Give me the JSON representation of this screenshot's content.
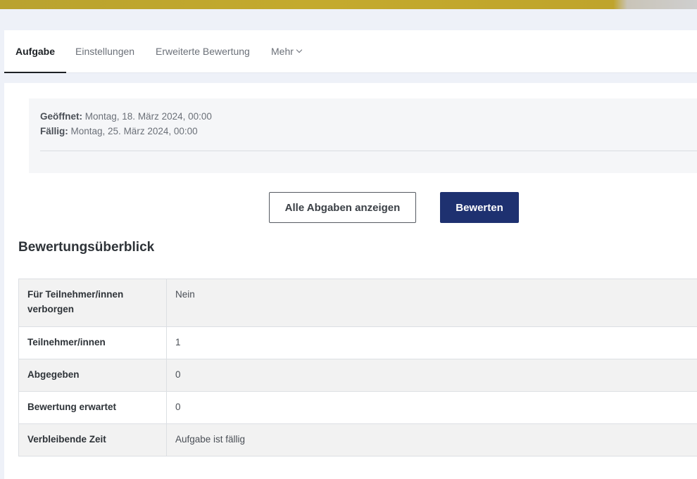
{
  "tabs": [
    {
      "label": "Aufgabe",
      "active": true
    },
    {
      "label": "Einstellungen",
      "active": false
    },
    {
      "label": "Erweiterte Bewertung",
      "active": false
    },
    {
      "label": "Mehr",
      "active": false
    }
  ],
  "dates": {
    "opened_label": "Geöffnet:",
    "opened_value": "Montag, 18. März 2024, 00:00",
    "due_label": "Fällig:",
    "due_value": "Montag, 25. März 2024, 00:00"
  },
  "actions": {
    "view_all_label": "Alle Abgaben anzeigen",
    "grade_label": "Bewerten"
  },
  "summary": {
    "title": "Bewertungsüberblick",
    "rows": [
      {
        "label": "Für Teilnehmer/innen verborgen",
        "value": "Nein"
      },
      {
        "label": "Teilnehmer/innen",
        "value": "1"
      },
      {
        "label": "Abgegeben",
        "value": "0"
      },
      {
        "label": "Bewertung erwartet",
        "value": "0"
      },
      {
        "label": "Verbleibende Zeit",
        "value": "Aufgabe ist fällig"
      }
    ]
  },
  "colors": {
    "primary": "#1e3170",
    "hero": "#c4aa2d"
  }
}
